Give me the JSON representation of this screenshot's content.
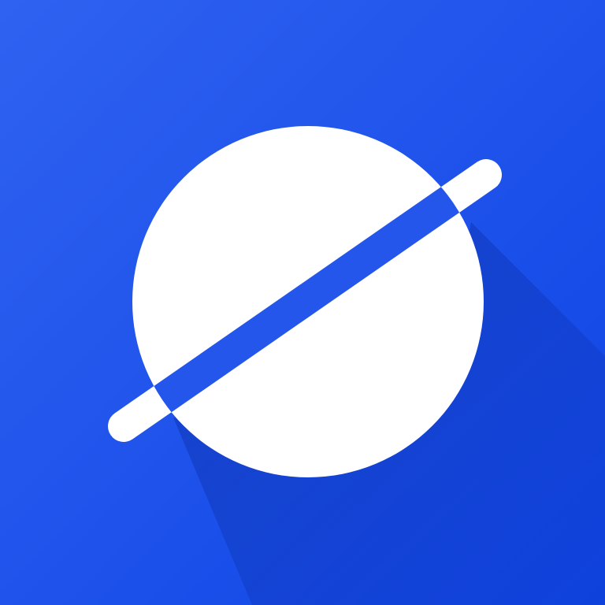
{
  "icon": {
    "name": "planet-icon",
    "colors": {
      "background_start": "#2F62F0",
      "background_end": "#0F44E6",
      "shadow": "#0B35B8",
      "planet": "#FFFFFF",
      "ring": "#FFFFFF",
      "ring_gap": "#2456EC"
    }
  }
}
